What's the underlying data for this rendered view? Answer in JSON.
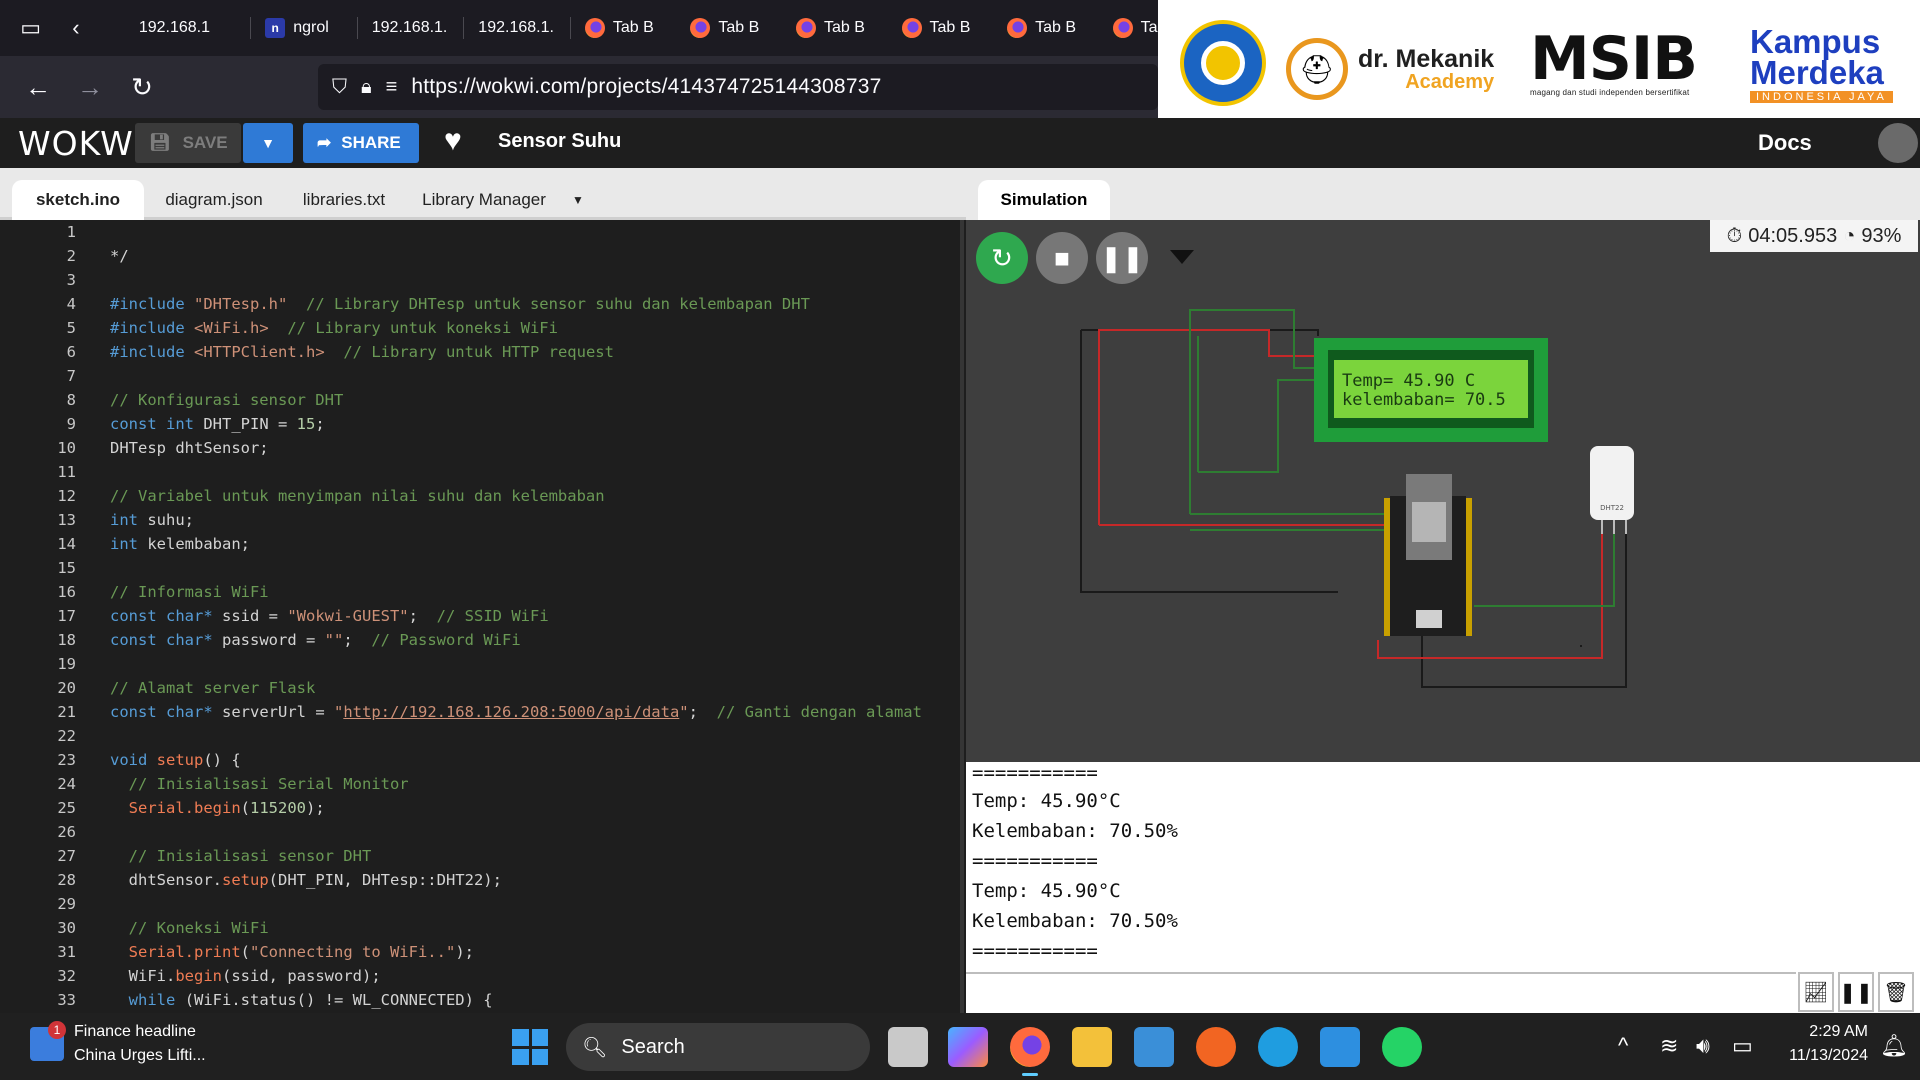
{
  "browser": {
    "tabs": [
      "192.168.1",
      "ngrol",
      "192.168.1.",
      "192.168.1.",
      "Tab B",
      "Tab B",
      "Tab B",
      "Tab B",
      "Tab B",
      "Tab"
    ],
    "url": "https://wokwi.com/projects/414374725144308737"
  },
  "logos": {
    "mekanik_name": "dr. Mekanik",
    "mekanik_sub": "Academy",
    "msib": "MSIB",
    "msib_tag": "magang dan studi independen bersertifikat",
    "kampus_line1": "Kampus",
    "kampus_line2": "Merdeka",
    "kampus_tag": "INDONESIA JAYA"
  },
  "wokwi": {
    "logo": "WOKWI",
    "save_label": "SAVE",
    "share_label": "SHARE",
    "project_title": "Sensor Suhu",
    "docs_label": "Docs"
  },
  "editor": {
    "tabs": [
      "sketch.ino",
      "diagram.json",
      "libraries.txt",
      "Library Manager"
    ],
    "active_tab": "sketch.ino"
  },
  "simulation": {
    "tab_label": "Simulation",
    "timer": "04:05.953",
    "speed": "93%",
    "lcd_line1": "Temp= 45.90 C",
    "lcd_line2": "kelembaban= 70.5",
    "dht_label": "DHT22"
  },
  "serial_monitor": {
    "lines": [
      "===========",
      "Temp: 45.90°C",
      "Kelembaban: 70.50%",
      "===========",
      "Temp: 45.90°C",
      "Kelembaban: 70.50%",
      "==========="
    ]
  },
  "taskbar": {
    "news_badge": "1",
    "news_title": "Finance headline",
    "news_sub": "China Urges Lifti...",
    "search_label": "Search",
    "time": "2:29 AM",
    "date": "11/13/2024"
  },
  "colors": {
    "editor_bg": "#1e1e1e",
    "sim_bg": "#3e3e3e",
    "wokwi_blue": "#2f7ad6",
    "run_green": "#2fa84f",
    "lcd_green": "#1f9d3a"
  },
  "icons": {
    "browser": [
      "tab-list-icon",
      "chevron-left-icon",
      "back-arrow-icon",
      "forward-arrow-icon",
      "reload-icon",
      "shield-icon",
      "lock-icon",
      "permissions-icon"
    ],
    "wokwi": [
      "save-icon",
      "share-icon",
      "heart-icon"
    ],
    "simulation": [
      "restart-icon",
      "stop-icon",
      "pause-icon",
      "stopwatch-icon",
      "speed-icon"
    ],
    "serial": [
      "plotter-icon",
      "pause-icon",
      "trash-icon"
    ],
    "taskbar": [
      "start-icon",
      "search-icon",
      "firefox-icon",
      "explorer-icon",
      "notepad-icon",
      "vscode-icon",
      "whatsapp-icon",
      "wifi-icon",
      "volume-icon",
      "battery-icon"
    ]
  }
}
